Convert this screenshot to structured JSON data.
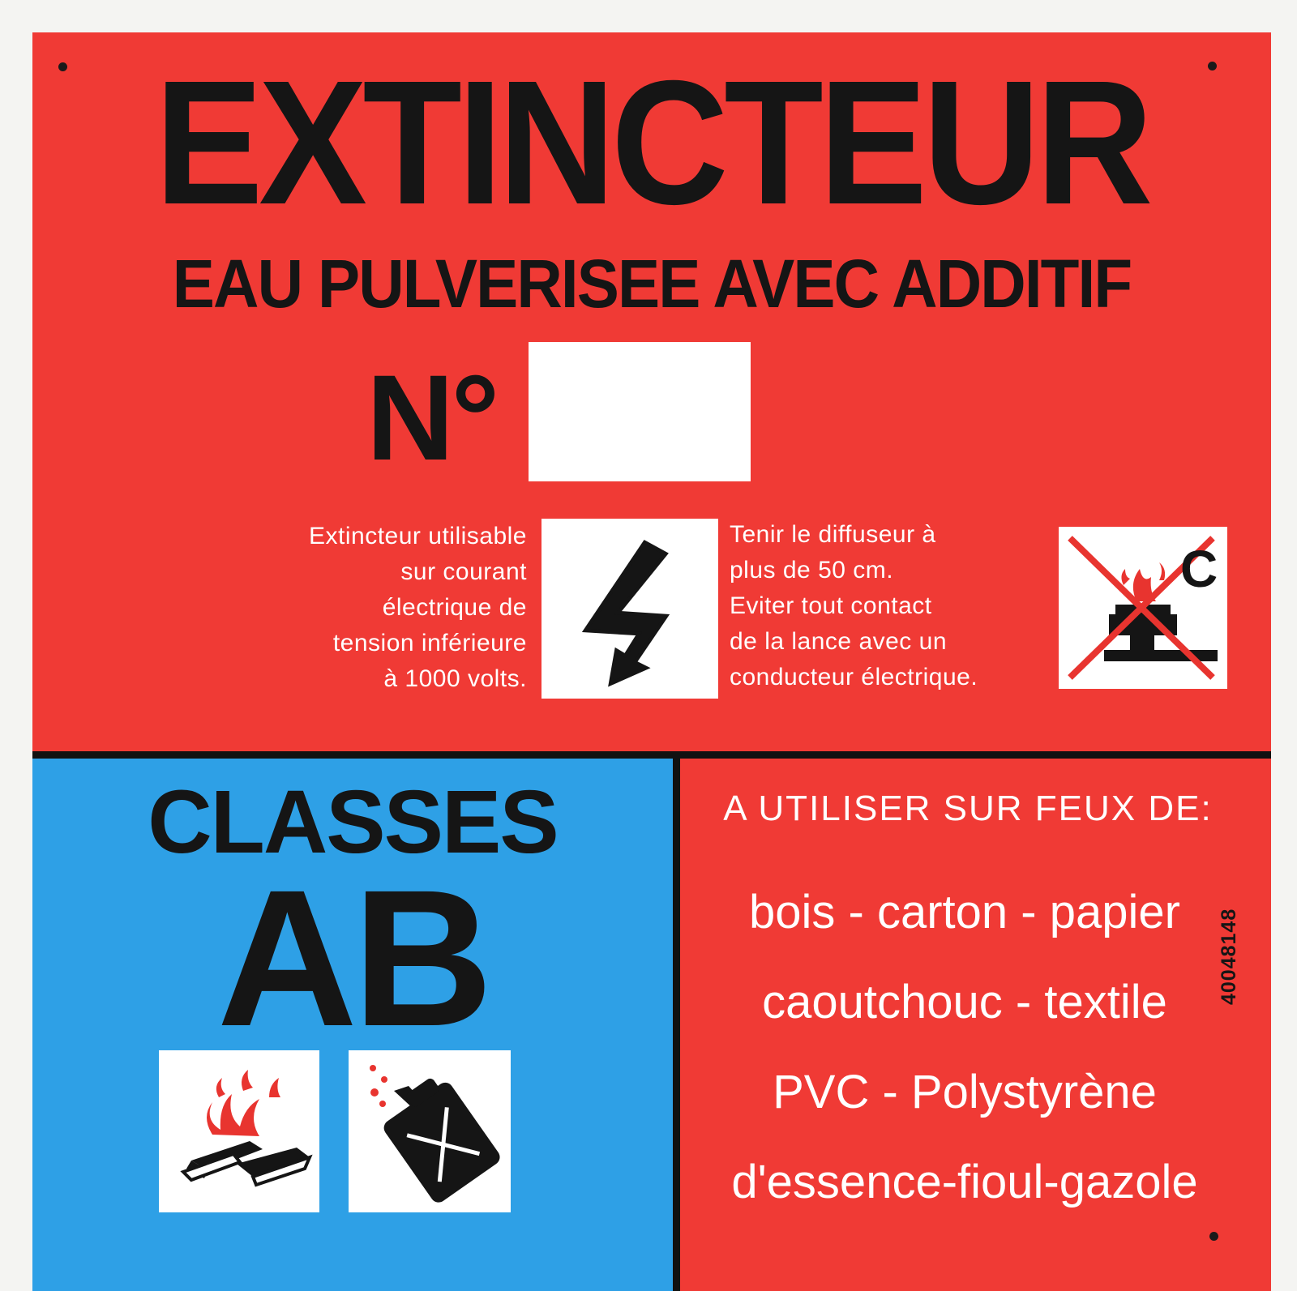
{
  "sign": {
    "title": "EXTINCTEUR",
    "subtitle": "EAU PULVERISEE AVEC ADDITIF",
    "number_label": "N°",
    "number_value": "",
    "electrical_note": [
      "Extincteur utilisable",
      "sur courant",
      "électrique de",
      "tension inférieure",
      "à 1000 volts."
    ],
    "diffuser_note": [
      "Tenir le diffuseur à",
      "plus de 50 cm.",
      "Eviter tout contact",
      "de la lance avec un",
      "conducteur électrique."
    ],
    "class_c_letter": "C",
    "classes_label": "CLASSES",
    "classes_value": "AB",
    "use_heading": "A UTILISER SUR FEUX DE:",
    "materials": [
      "bois - carton - papier",
      "caoutchouc - textile",
      "PVC - Polystyrène",
      "d'essence-fioul-gazole"
    ],
    "reference_code": "40048148"
  },
  "icons": {
    "electric": "lightning-bolt-icon",
    "class_c": "no-gas-fire-icon",
    "class_a": "burning-wood-icon",
    "class_b": "fuel-can-icon"
  },
  "colors": {
    "red": "#f03a35",
    "blue": "#2ea0e6",
    "black": "#151515",
    "white": "#ffffff"
  }
}
